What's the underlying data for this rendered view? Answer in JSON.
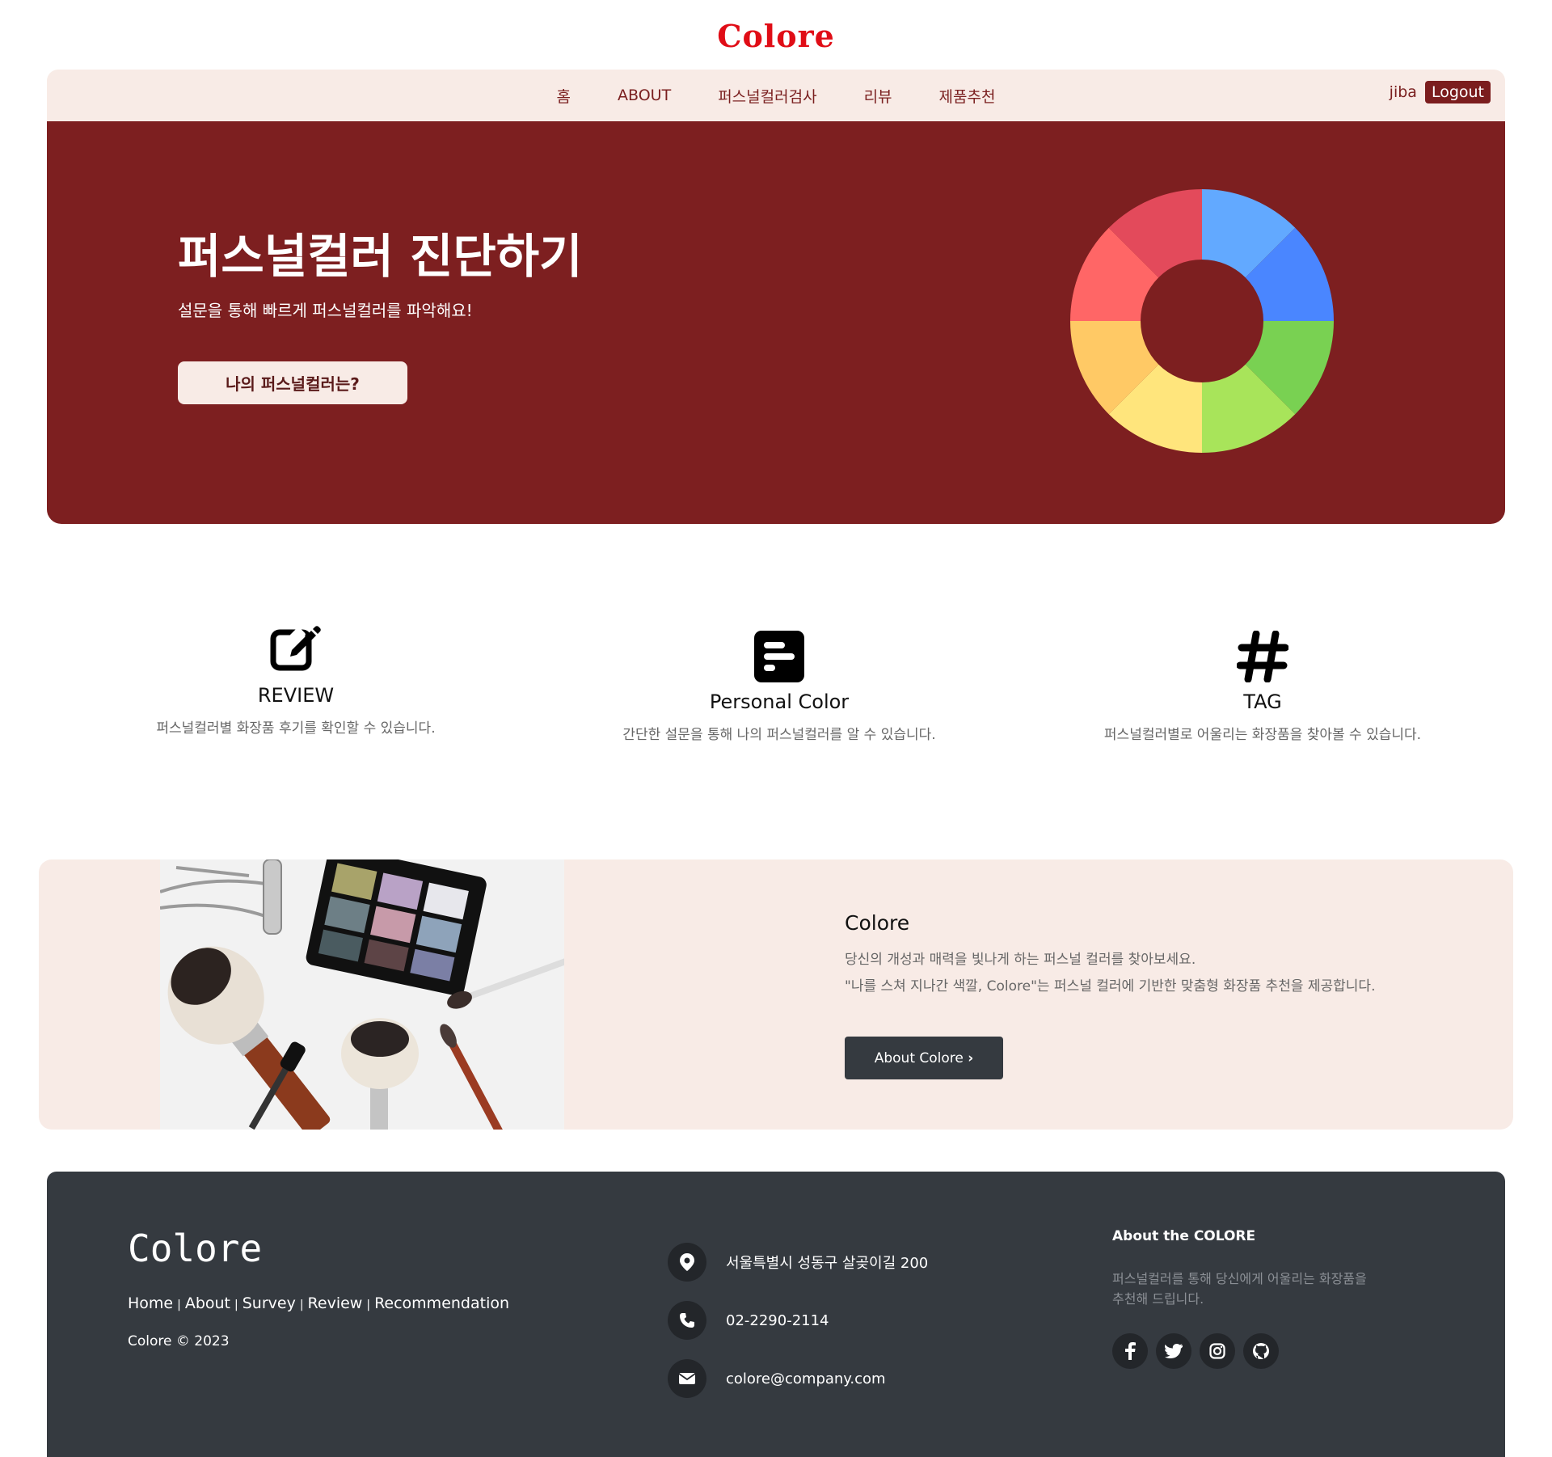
{
  "brand": "Colore",
  "nav": {
    "items": [
      "홈",
      "ABOUT",
      "퍼스널컬러검사",
      "리뷰",
      "제품추천"
    ],
    "user": "jiba",
    "logout": "Logout"
  },
  "hero": {
    "title": "퍼스널컬러 진단하기",
    "subtitle": "설문을 통해 빠르게 퍼스널컬러를 파악해요!",
    "cta": "나의 퍼스널컬러는?",
    "wheel_colors": [
      "#62a9ff",
      "#4a86ff",
      "#79d152",
      "#a8e45a",
      "#ffe57c",
      "#ffc965",
      "#ff6666",
      "#e34a5b"
    ],
    "accent": "#7d1f20"
  },
  "features": [
    {
      "icon": "edit-icon",
      "title": "REVIEW",
      "desc": "퍼스널컬러별 화장품 후기를 확인할 수 있습니다."
    },
    {
      "icon": "poll-icon",
      "title": "Personal Color",
      "desc": "간단한 설문을 통해 나의 퍼스널컬러를 알 수 있습니다."
    },
    {
      "icon": "hashtag-icon",
      "title": "TAG",
      "desc": "퍼스널컬러별로 어울리는 화장품을 찾아볼 수 있습니다."
    }
  ],
  "about": {
    "title": "Colore",
    "line1": "당신의 개성과 매력을 빛나게 하는 퍼스널 컬러를 찾아보세요.",
    "line2": "\"나를 스쳐 지나간 색깔, Colore\"는 퍼스널 컬러에 기반한 맞춤형 화장품 추천을 제공합니다.",
    "button": "About Colore"
  },
  "footer": {
    "logo": "Colore",
    "links": [
      "Home",
      "About",
      "Survey",
      "Review",
      "Recommendation"
    ],
    "copyright": "Colore © 2023",
    "address": "서울특별시 성동구 살곶이길 200",
    "phone": "02-2290-2114",
    "email": "colore@company.com",
    "about_title": "About the COLORE",
    "about_text": "퍼스널컬러를 통해 당신에게 어울리는 화장품을 추천해 드립니다.",
    "social": [
      "facebook-icon",
      "twitter-icon",
      "instagram-icon",
      "github-icon"
    ]
  }
}
